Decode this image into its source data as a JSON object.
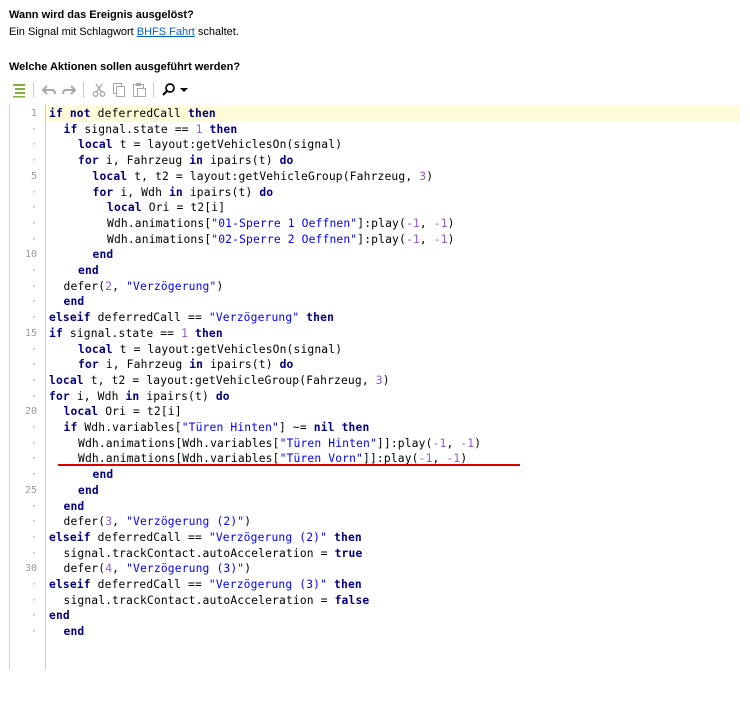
{
  "trigger": {
    "heading": "Wann wird das Ereignis ausgelöst?",
    "desc_prefix": "Ein Signal mit Schlagwort ",
    "tag_link": "BHFS Fahrt",
    "desc_suffix": " schaltet."
  },
  "actions": {
    "heading": "Welche Aktionen sollen ausgeführt werden?"
  },
  "toolbar": {
    "icons": [
      "list-icon",
      "undo-icon",
      "redo-icon",
      "cut-icon",
      "copy-icon",
      "paste-icon",
      "search-icon",
      "dropdown-arrow-icon"
    ]
  },
  "editor": {
    "colors": {
      "keyword": "#000080",
      "string": "#0000ff",
      "number": "#8a5cd6",
      "highlight": "#fffbd8",
      "annotation": "#e00000"
    },
    "lines": [
      {
        "no": "1",
        "indent": 0,
        "tokens": [
          [
            "kw",
            "if not "
          ],
          [
            "t",
            "deferredCall "
          ],
          [
            "kw",
            "then"
          ]
        ]
      },
      {
        "no": "·",
        "indent": 1,
        "tokens": [
          [
            "kw",
            "if "
          ],
          [
            "t",
            "signal.state == "
          ],
          [
            "num",
            "1"
          ],
          [
            "kw",
            " then"
          ]
        ]
      },
      {
        "no": "·",
        "indent": 2,
        "tokens": [
          [
            "kw",
            "local "
          ],
          [
            "t",
            "t = layout:getVehiclesOn(signal)"
          ]
        ]
      },
      {
        "no": "·",
        "indent": 2,
        "tokens": [
          [
            "kw",
            "for "
          ],
          [
            "t",
            "i, Fahrzeug "
          ],
          [
            "kw",
            "in "
          ],
          [
            "t",
            "ipairs(t) "
          ],
          [
            "kw",
            "do"
          ]
        ]
      },
      {
        "no": "5",
        "indent": 3,
        "tokens": [
          [
            "kw",
            "local "
          ],
          [
            "t",
            "t, t2 = layout:getVehicleGroup(Fahrzeug, "
          ],
          [
            "num",
            "3"
          ],
          [
            "t",
            ")"
          ]
        ]
      },
      {
        "no": "·",
        "indent": 3,
        "tokens": [
          [
            "kw",
            "for "
          ],
          [
            "t",
            "i, Wdh "
          ],
          [
            "kw",
            "in "
          ],
          [
            "t",
            "ipairs(t) "
          ],
          [
            "kw",
            "do"
          ]
        ]
      },
      {
        "no": "·",
        "indent": 4,
        "tokens": [
          [
            "kw",
            "local "
          ],
          [
            "t",
            "Ori = t2[i]"
          ]
        ]
      },
      {
        "no": "·",
        "indent": 4,
        "tokens": [
          [
            "t",
            "Wdh.animations["
          ],
          [
            "str",
            "\"01-Sperre 1 Oeffnen\""
          ],
          [
            "t",
            "]:play("
          ],
          [
            "num",
            "-1"
          ],
          [
            "t",
            ", "
          ],
          [
            "num",
            "-1"
          ],
          [
            "t",
            ")"
          ]
        ]
      },
      {
        "no": "·",
        "indent": 4,
        "tokens": [
          [
            "t",
            "Wdh.animations["
          ],
          [
            "str",
            "\"02-Sperre 2 Oeffnen\""
          ],
          [
            "t",
            "]:play("
          ],
          [
            "num",
            "-1"
          ],
          [
            "t",
            ", "
          ],
          [
            "num",
            "-1"
          ],
          [
            "t",
            ")"
          ]
        ]
      },
      {
        "no": "10",
        "indent": 3,
        "tokens": [
          [
            "kw",
            "end"
          ]
        ]
      },
      {
        "no": "·",
        "indent": 2,
        "tokens": [
          [
            "kw",
            "end"
          ]
        ]
      },
      {
        "no": "·",
        "indent": 1,
        "tokens": [
          [
            "t",
            "defer("
          ],
          [
            "num",
            "2"
          ],
          [
            "t",
            ", "
          ],
          [
            "str",
            "\"Verzögerung\""
          ],
          [
            "t",
            ")"
          ]
        ]
      },
      {
        "no": "·",
        "indent": 1,
        "tokens": [
          [
            "kw",
            "end"
          ]
        ]
      },
      {
        "no": "·",
        "indent": 0,
        "tokens": [
          [
            "kw",
            "elseif "
          ],
          [
            "t",
            "deferredCall == "
          ],
          [
            "str",
            "\"Verzögerung\""
          ],
          [
            "kw",
            " then"
          ]
        ]
      },
      {
        "no": "15",
        "indent": 0,
        "tokens": [
          [
            "kw",
            "if "
          ],
          [
            "t",
            "signal.state == "
          ],
          [
            "num",
            "1"
          ],
          [
            "kw",
            " then"
          ]
        ]
      },
      {
        "no": "·",
        "indent": 2,
        "tokens": [
          [
            "kw",
            "local "
          ],
          [
            "t",
            "t = layout:getVehiclesOn(signal)"
          ]
        ]
      },
      {
        "no": "·",
        "indent": 2,
        "tokens": [
          [
            "kw",
            "for "
          ],
          [
            "t",
            "i, Fahrzeug "
          ],
          [
            "kw",
            "in "
          ],
          [
            "t",
            "ipairs(t) "
          ],
          [
            "kw",
            "do"
          ]
        ]
      },
      {
        "no": "·",
        "indent": 0,
        "tokens": [
          [
            "kw",
            "local "
          ],
          [
            "t",
            "t, t2 = layout:getVehicleGroup(Fahrzeug, "
          ],
          [
            "num",
            "3"
          ],
          [
            "t",
            ")"
          ]
        ]
      },
      {
        "no": "·",
        "indent": 0,
        "tokens": [
          [
            "kw",
            "for "
          ],
          [
            "t",
            "i, Wdh "
          ],
          [
            "kw",
            "in "
          ],
          [
            "t",
            "ipairs(t) "
          ],
          [
            "kw",
            "do"
          ]
        ]
      },
      {
        "no": "20",
        "indent": 1,
        "tokens": [
          [
            "kw",
            "local "
          ],
          [
            "t",
            "Ori = t2[i]"
          ]
        ]
      },
      {
        "no": "·",
        "indent": 1,
        "tokens": [
          [
            "kw",
            "if "
          ],
          [
            "t",
            "Wdh.variables["
          ],
          [
            "str",
            "\"Türen Hinten\""
          ],
          [
            "t",
            "] ~= "
          ],
          [
            "kw",
            "nil then"
          ]
        ]
      },
      {
        "no": "·",
        "indent": 2,
        "tokens": [
          [
            "t",
            "Wdh.animations[Wdh.variables["
          ],
          [
            "str",
            "\"Türen Hinten\""
          ],
          [
            "t",
            "]]:play("
          ],
          [
            "num",
            "-1"
          ],
          [
            "t",
            ", "
          ],
          [
            "num",
            "-1"
          ],
          [
            "t",
            ")"
          ]
        ]
      },
      {
        "no": "·",
        "indent": 2,
        "tokens": [
          [
            "t",
            "Wdh.animations[Wdh.variables["
          ],
          [
            "str",
            "\"Türen Vorn\""
          ],
          [
            "t",
            "]]:play("
          ],
          [
            "num",
            "-1"
          ],
          [
            "t",
            ", "
          ],
          [
            "num",
            "-1"
          ],
          [
            "t",
            ")"
          ]
        ]
      },
      {
        "no": "·",
        "indent": 3,
        "tokens": [
          [
            "kw",
            "end"
          ]
        ]
      },
      {
        "no": "25",
        "indent": 2,
        "tokens": [
          [
            "kw",
            "end"
          ]
        ]
      },
      {
        "no": "·",
        "indent": 1,
        "tokens": [
          [
            "kw",
            "end"
          ]
        ]
      },
      {
        "no": "·",
        "indent": 1,
        "tokens": [
          [
            "t",
            "defer("
          ],
          [
            "num",
            "3"
          ],
          [
            "t",
            ", "
          ],
          [
            "str",
            "\"Verzögerung (2)\""
          ],
          [
            "t",
            ")"
          ]
        ]
      },
      {
        "no": "·",
        "indent": 0,
        "tokens": [
          [
            "kw",
            "elseif "
          ],
          [
            "t",
            "deferredCall == "
          ],
          [
            "str",
            "\"Verzögerung (2)\""
          ],
          [
            "kw",
            " then"
          ]
        ]
      },
      {
        "no": "·",
        "indent": 1,
        "tokens": [
          [
            "t",
            "signal.trackContact.autoAcceleration = "
          ],
          [
            "kw",
            "true"
          ]
        ]
      },
      {
        "no": "30",
        "indent": 1,
        "tokens": [
          [
            "t",
            "defer("
          ],
          [
            "num",
            "4"
          ],
          [
            "t",
            ", "
          ],
          [
            "str",
            "\"Verzögerung (3)\""
          ],
          [
            "t",
            ")"
          ]
        ]
      },
      {
        "no": "·",
        "indent": 0,
        "tokens": [
          [
            "kw",
            "elseif "
          ],
          [
            "t",
            "deferredCall == "
          ],
          [
            "str",
            "\"Verzögerung (3)\""
          ],
          [
            "kw",
            " then"
          ]
        ]
      },
      {
        "no": "·",
        "indent": 1,
        "tokens": [
          [
            "t",
            "signal.trackContact.autoAcceleration = "
          ],
          [
            "kw",
            "false"
          ]
        ]
      },
      {
        "no": "·",
        "indent": 0,
        "tokens": [
          [
            "kw",
            "end"
          ]
        ]
      },
      {
        "no": "·",
        "indent": 1,
        "tokens": [
          [
            "kw",
            "end"
          ]
        ]
      }
    ]
  }
}
